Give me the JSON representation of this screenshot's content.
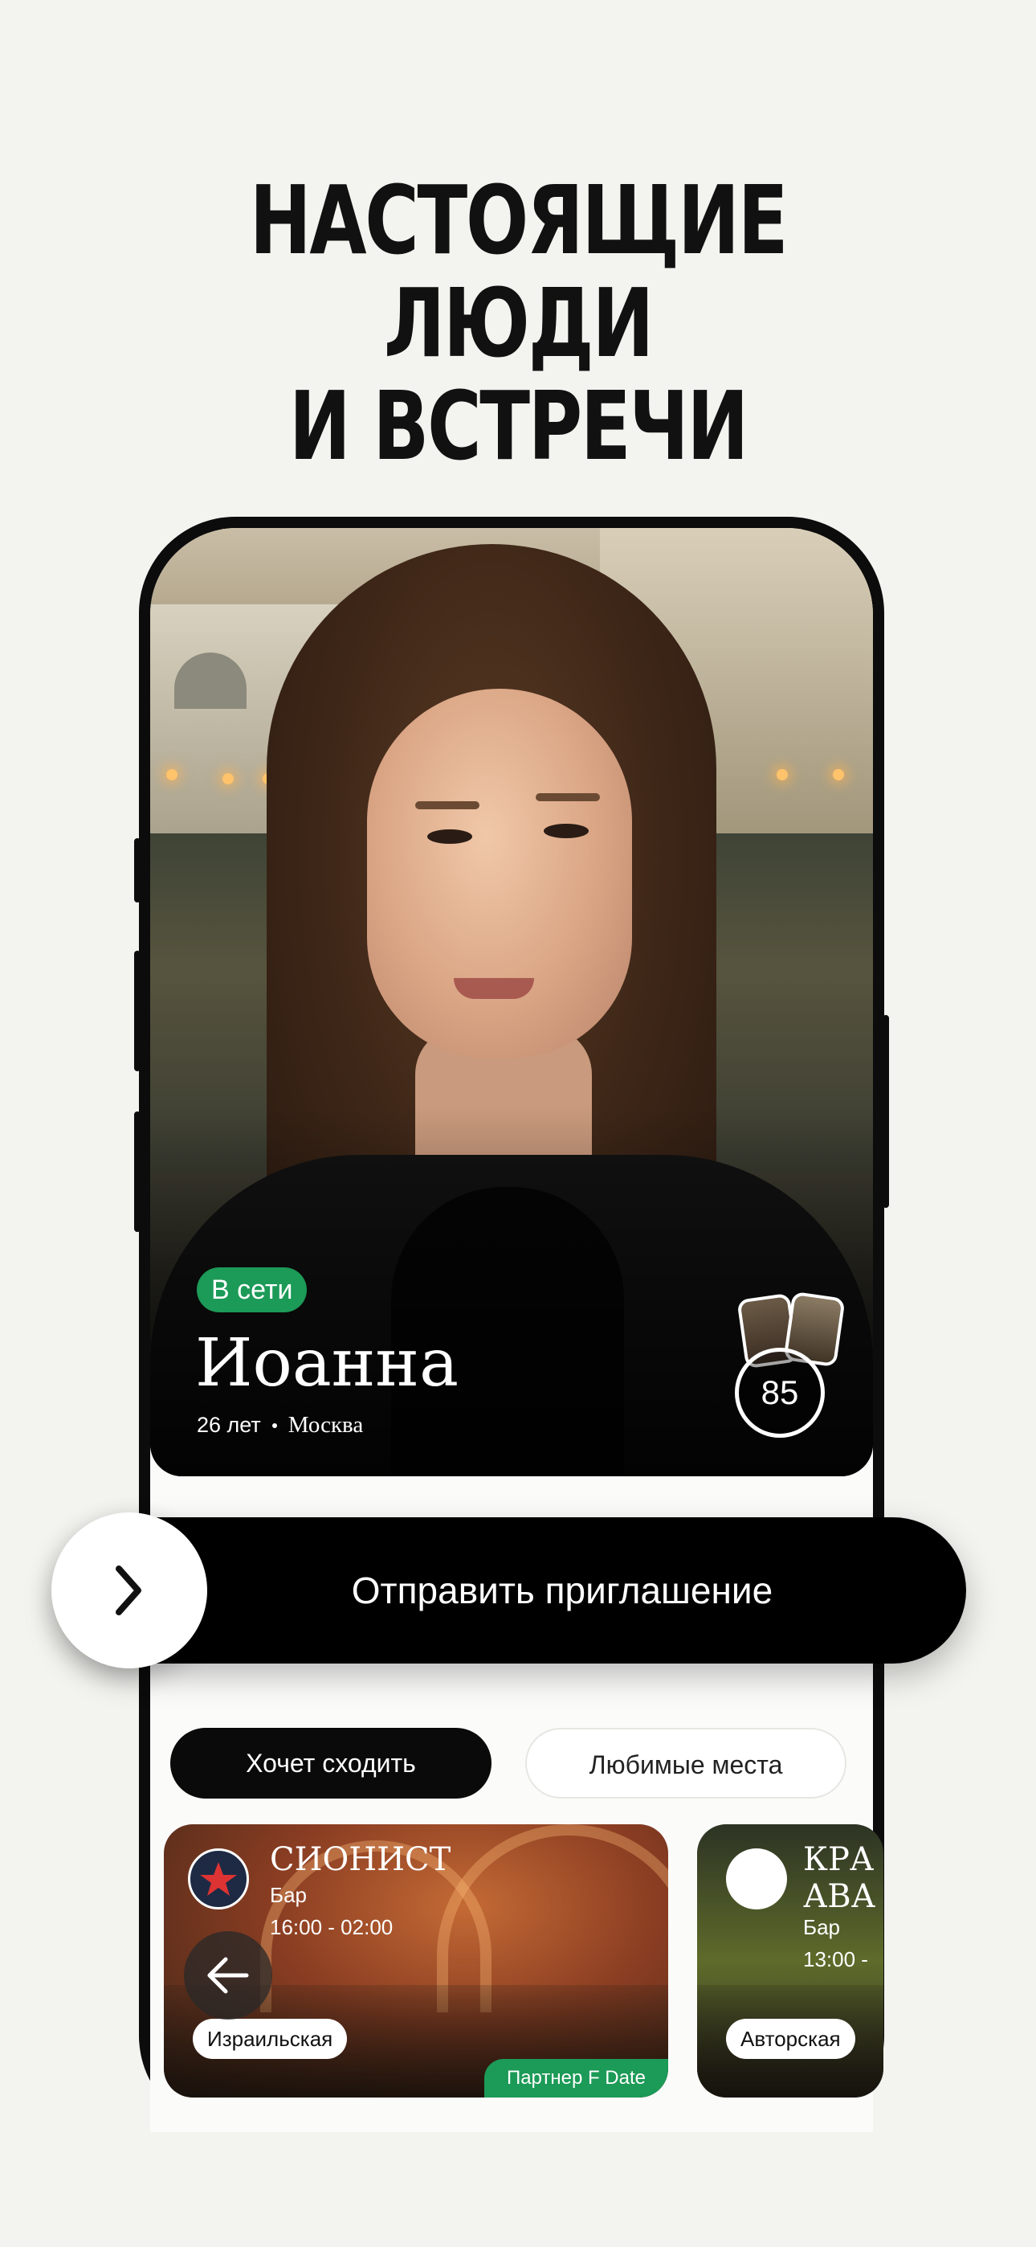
{
  "headline": {
    "line1": "НАСТОЯЩИЕ ЛЮДИ",
    "line2": "И ВСТРЕЧИ"
  },
  "profile": {
    "status": "В сети",
    "name": "Иоанна",
    "age": "26 лет",
    "city": "Москва",
    "match_score": "85"
  },
  "invite": {
    "label": "Отправить приглашение",
    "icon": "chevron-right-icon"
  },
  "tabs": [
    {
      "label": "Хочет сходить",
      "active": true
    },
    {
      "label": "Любимые места",
      "active": false
    }
  ],
  "venues": [
    {
      "name": "СИОНИСТ",
      "type": "Бар",
      "hours": "16:00 - 02:00",
      "tag": "Израильская",
      "partner": "Партнер F Date"
    },
    {
      "name": "КРАСИВЫЕ АВА",
      "name_line1": "КРА",
      "name_line2": "АВА",
      "type": "Бар",
      "hours": "13:00 -",
      "tag": "Авторская"
    }
  ],
  "colors": {
    "accent_green": "#1c9a57",
    "background": "#f3f3ef",
    "primary": "#000000"
  }
}
